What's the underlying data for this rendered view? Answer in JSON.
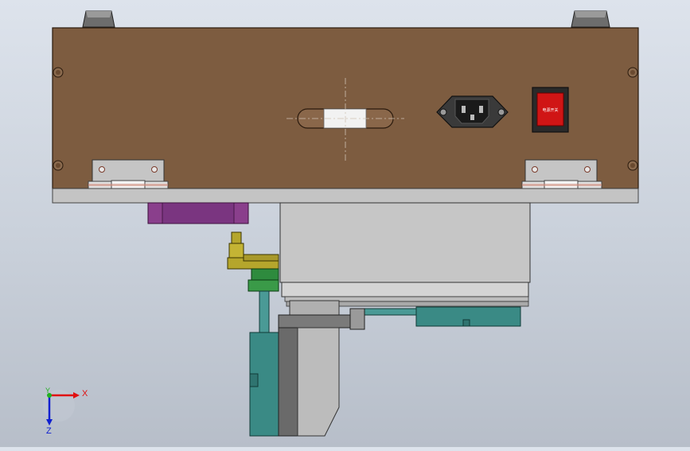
{
  "switch": {
    "label": "电源开关"
  },
  "triad": {
    "x_label": "X",
    "y_label": "Y",
    "z_label": "Z"
  },
  "colors": {
    "wood": "#7d5c40",
    "shelf": "#c4c4c4",
    "steel": "#c5c5c5",
    "purple": "#8a3f8c",
    "teal": "#3a8a85",
    "green": "#2e8b3e",
    "olive": "#b5a62c",
    "switch_red": "#d01515",
    "axis_x": "#e01010",
    "axis_y": "#20b020",
    "axis_z": "#1020d0"
  }
}
